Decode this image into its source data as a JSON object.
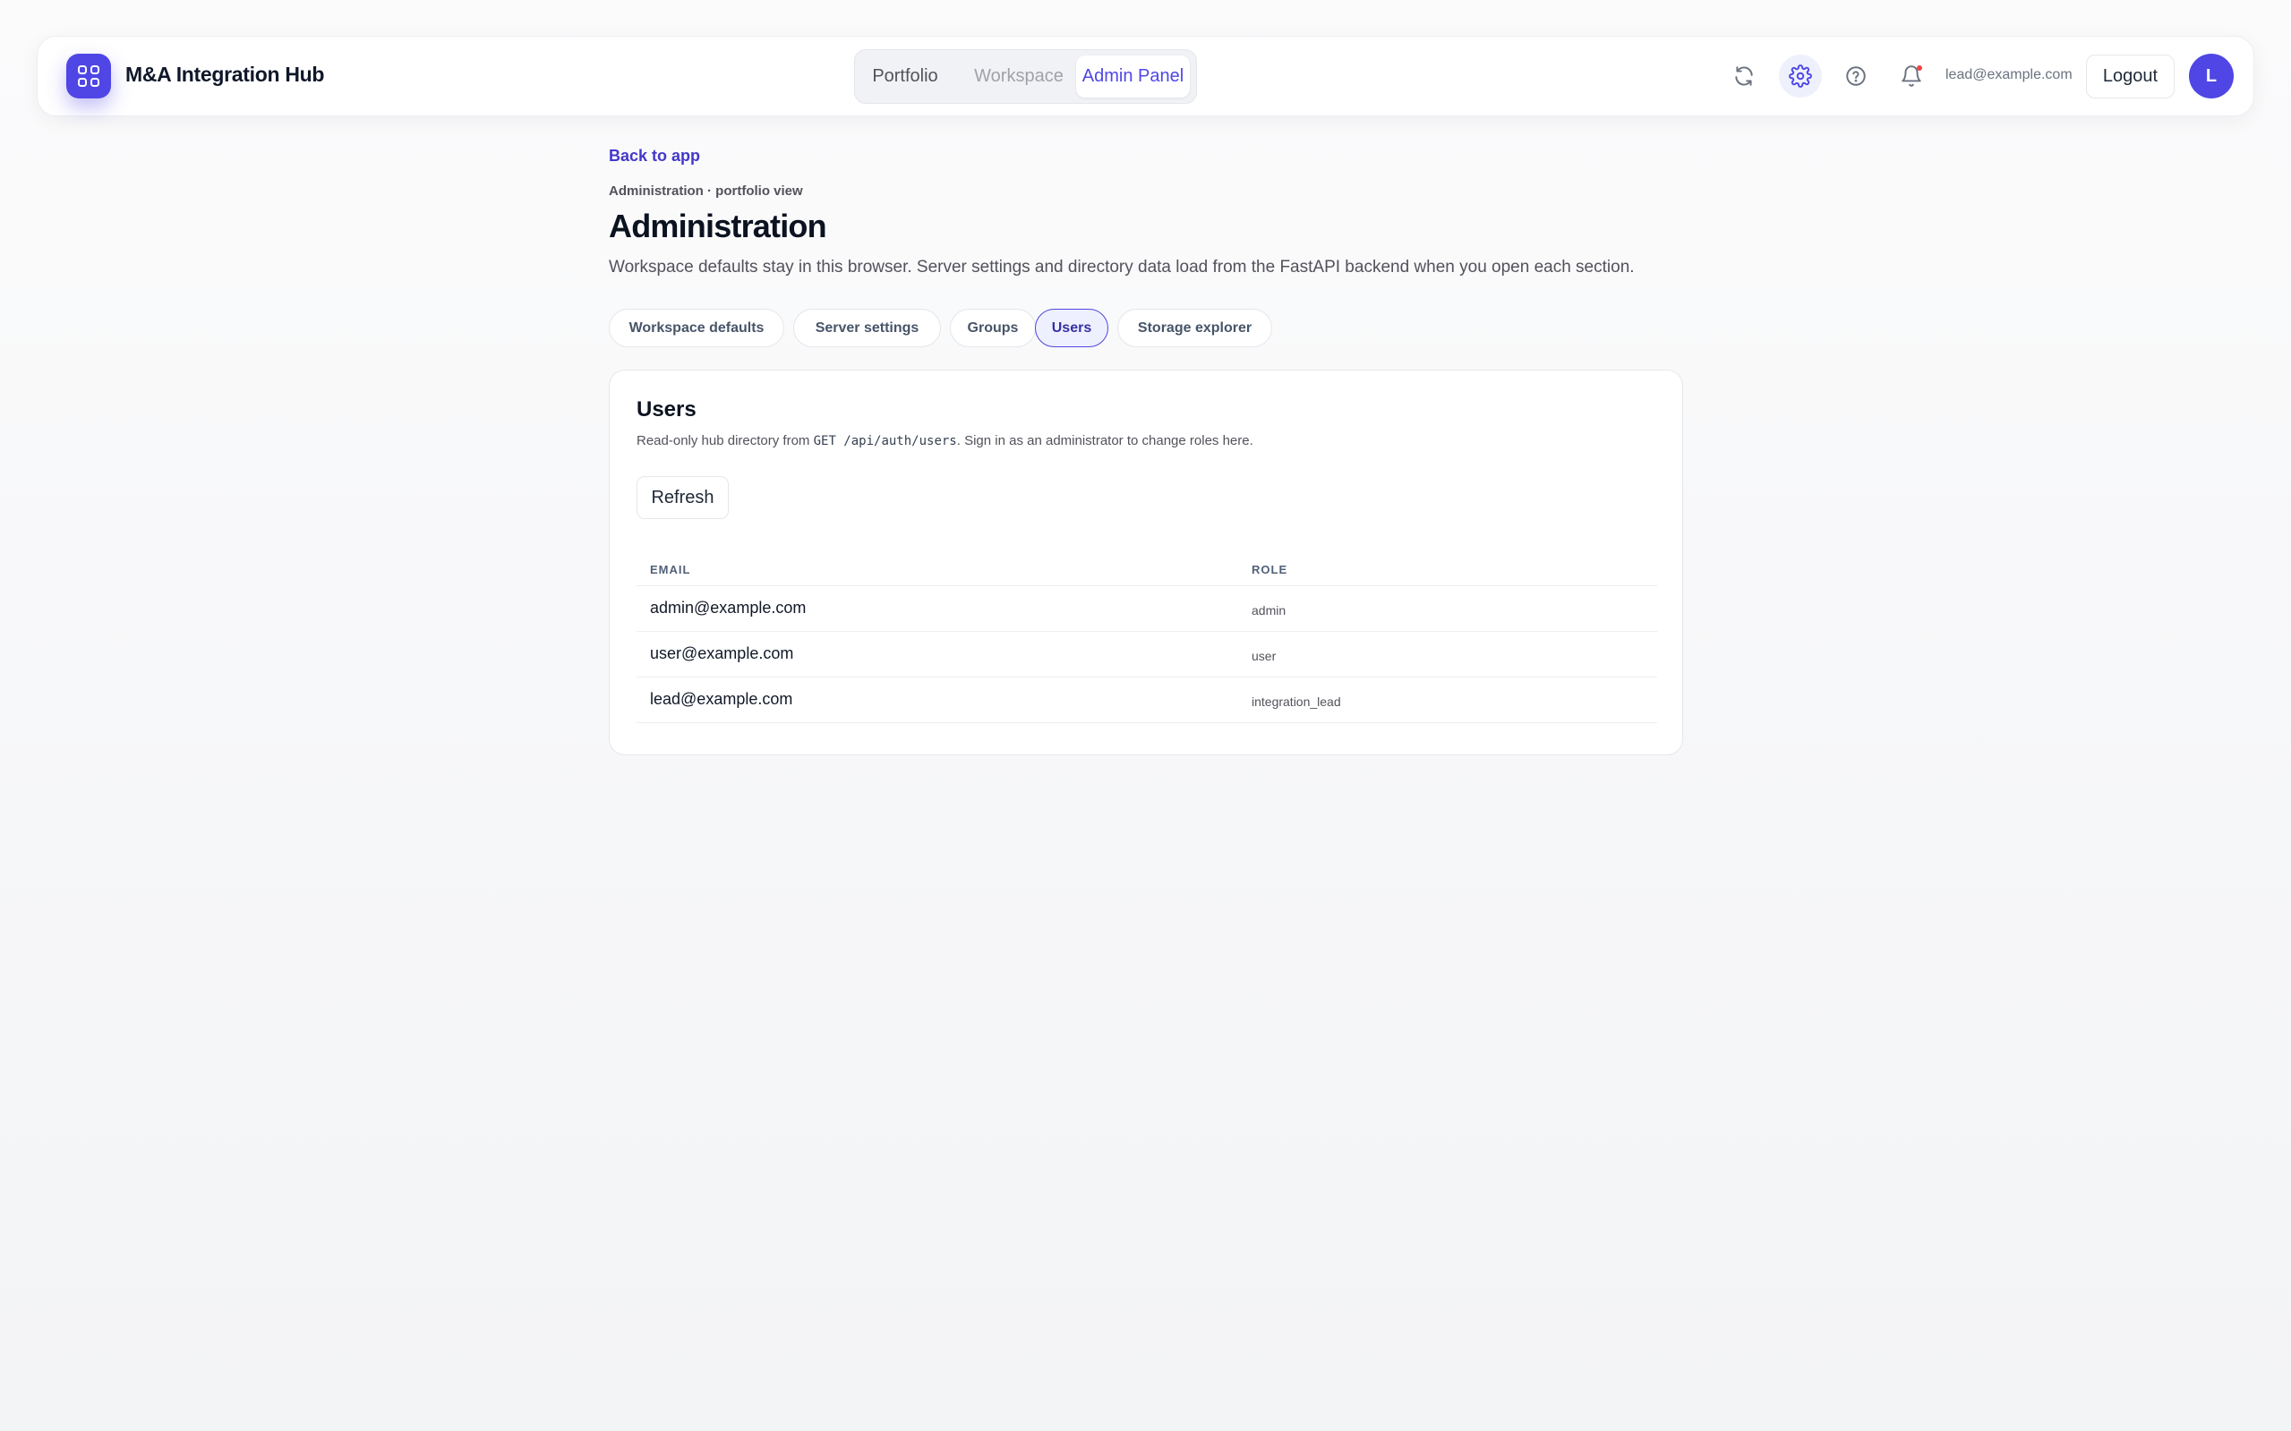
{
  "app": {
    "title": "M&A Integration Hub",
    "brand_color": "#4f46e5"
  },
  "nav": {
    "tabs": [
      {
        "label": "Portfolio",
        "state": "default"
      },
      {
        "label": "Workspace",
        "state": "disabled"
      },
      {
        "label": "Admin Panel",
        "state": "active"
      }
    ]
  },
  "header": {
    "icons": [
      "refresh-icon",
      "settings-icon",
      "help-icon",
      "bell-icon"
    ],
    "user_email": "lead@example.com",
    "logout_label": "Logout",
    "avatar_initial": "L"
  },
  "page": {
    "back_link": "Back to app",
    "breadcrumb": "Administration · portfolio view",
    "title": "Administration",
    "subtitle": "Workspace defaults stay in this browser. Server settings and directory data load from the FastAPI backend when you open each section."
  },
  "section_tabs": [
    {
      "label": "Workspace defaults",
      "active": false
    },
    {
      "label": "Server settings",
      "active": false
    },
    {
      "label": "Groups",
      "active": false
    },
    {
      "label": "Users",
      "active": true
    },
    {
      "label": "Storage explorer",
      "active": false
    }
  ],
  "users_card": {
    "title": "Users",
    "desc_before": "Read-only hub directory from ",
    "desc_code": "GET /api/auth/users",
    "desc_after": ". Sign in as an administrator to change roles here.",
    "refresh_label": "Refresh",
    "columns": [
      "Email",
      "Role"
    ],
    "rows": [
      {
        "email": "admin@example.com",
        "role": "admin"
      },
      {
        "email": "user@example.com",
        "role": "user"
      },
      {
        "email": "lead@example.com",
        "role": "integration_lead"
      }
    ]
  }
}
